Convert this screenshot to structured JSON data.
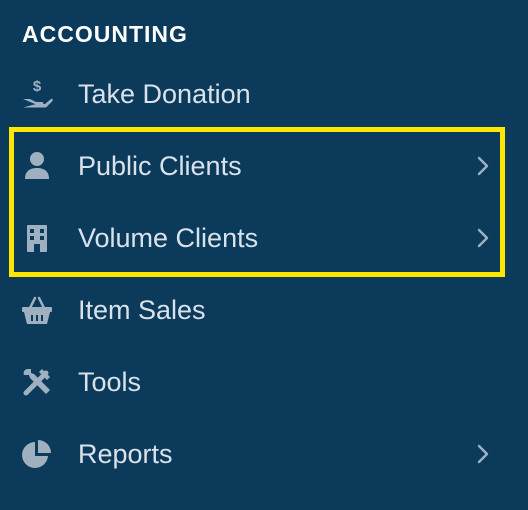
{
  "sidebar": {
    "section_title": "ACCOUNTING",
    "items": [
      {
        "label": "Take Donation",
        "icon": "hand-dollar-icon",
        "has_submenu": false
      },
      {
        "label": "Public Clients",
        "icon": "user-icon",
        "has_submenu": true
      },
      {
        "label": "Volume Clients",
        "icon": "building-icon",
        "has_submenu": true
      },
      {
        "label": "Item Sales",
        "icon": "basket-icon",
        "has_submenu": false
      },
      {
        "label": "Tools",
        "icon": "tools-icon",
        "has_submenu": false
      },
      {
        "label": "Reports",
        "icon": "pie-chart-icon",
        "has_submenu": true
      }
    ]
  },
  "colors": {
    "background": "#0c3a5b",
    "text": "#d9e2ea",
    "icon": "#9fb1c1",
    "highlight": "#ffe600"
  }
}
